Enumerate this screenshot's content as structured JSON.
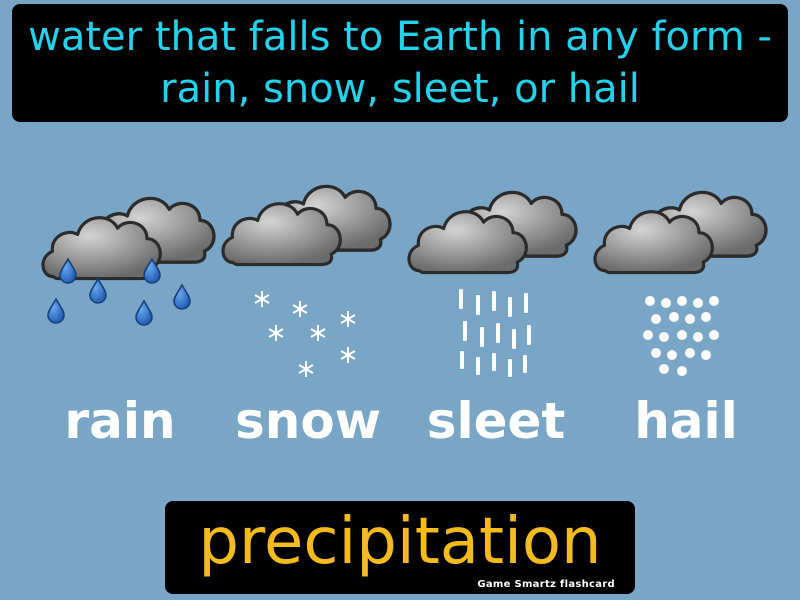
{
  "definition": "water that falls to Earth in any form - rain, snow, sleet, or hail",
  "panels": [
    {
      "label": "rain",
      "icon": "rain-cloud-icon"
    },
    {
      "label": "snow",
      "icon": "snow-cloud-icon"
    },
    {
      "label": "sleet",
      "icon": "sleet-cloud-icon"
    },
    {
      "label": "hail",
      "icon": "hail-cloud-icon"
    }
  ],
  "term": "precipitation",
  "credit": "Game Smartz flashcard",
  "colors": {
    "background": "#79a6c6",
    "definition_text": "#22d3ee",
    "term_text": "#f5bb1d",
    "label_text": "#ffffff",
    "rain_drop": "#2f6fc4"
  }
}
